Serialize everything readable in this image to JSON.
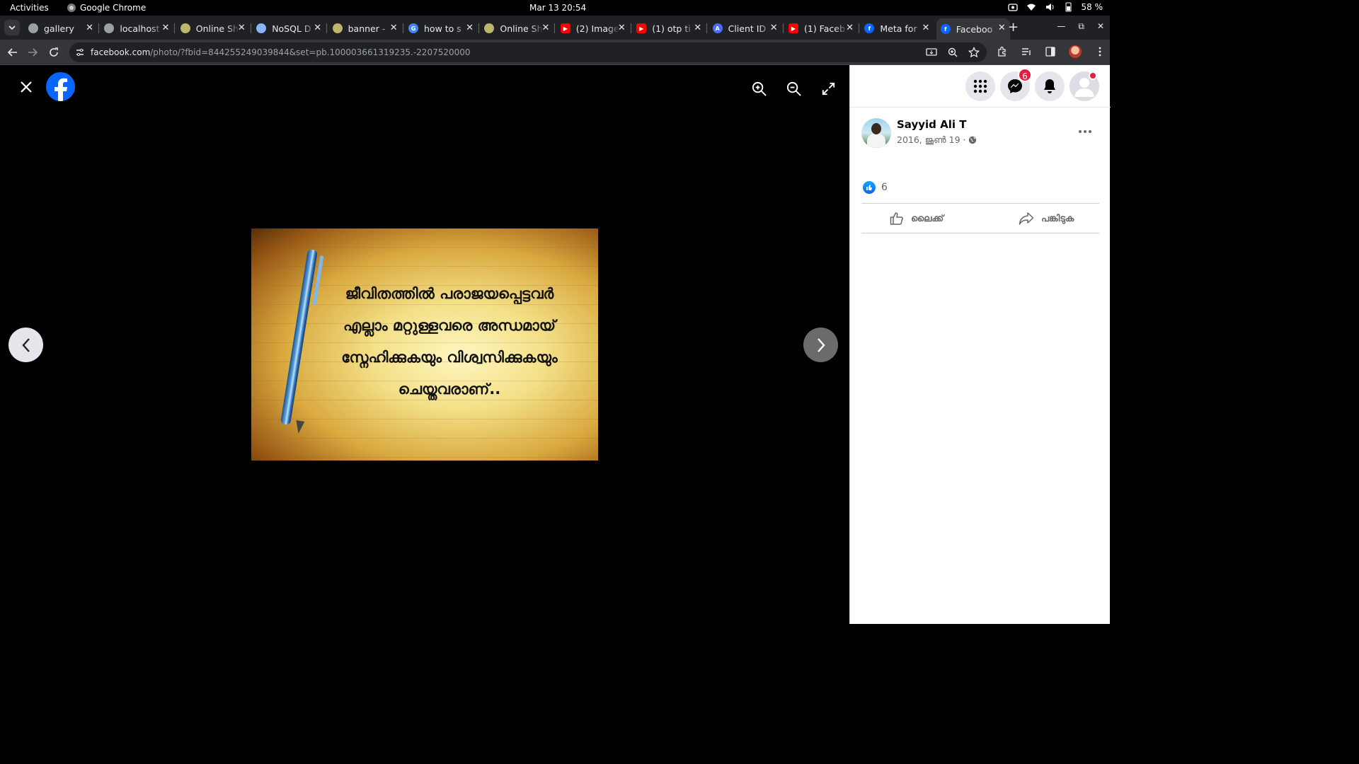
{
  "system": {
    "activities": "Activities",
    "app_name": "Google Chrome",
    "datetime": "Mar 13  20:54",
    "battery": "58 %"
  },
  "tabs": [
    {
      "title": "gallery",
      "favicon": "globe-icon"
    },
    {
      "title": "localhost",
      "favicon": "globe-icon"
    },
    {
      "title": "Online Sh",
      "favicon": "site-icon"
    },
    {
      "title": "NoSQL D",
      "favicon": "doc-icon"
    },
    {
      "title": "banner - ",
      "favicon": "site-icon"
    },
    {
      "title": "how to s",
      "favicon": "google-icon"
    },
    {
      "title": "Online Sh",
      "favicon": "site-icon"
    },
    {
      "title": "(2) Image",
      "favicon": "youtube-icon"
    },
    {
      "title": "(1) otp ti",
      "favicon": "youtube-icon"
    },
    {
      "title": "Client ID",
      "favicon": "api-icon"
    },
    {
      "title": "(1) Faceb",
      "favicon": "youtube-icon"
    },
    {
      "title": "Meta for ",
      "favicon": "facebook-icon"
    },
    {
      "title": "Faceboo",
      "favicon": "facebook-icon",
      "active": true
    }
  ],
  "address": {
    "domain": "facebook.com",
    "path": "/photo/?fbid=844255249039844&set=pb.100003661319235.-2207520000"
  },
  "photo": {
    "quote_lines": [
      "ജീവിതത്തിൽ പരാജയപ്പെട്ടവർ",
      "എല്ലാം മറ്റുള്ളവരെ അന്ധമായ്",
      "സ്നേഹിക്കുകയും വിശ്വസിക്കുകയും",
      "ചെയ്തവരാണ്.."
    ]
  },
  "panel": {
    "messenger_badge": "6",
    "author": "Sayyid Ali T",
    "post_date": "2016, ജൂൺ 19 ·",
    "like_count": "6",
    "like_label": "ലൈക്ക്",
    "share_label": "പങ്കിടുക"
  },
  "colors": {
    "facebook_blue": "#0866ff",
    "badge_red": "#e41e3f"
  }
}
